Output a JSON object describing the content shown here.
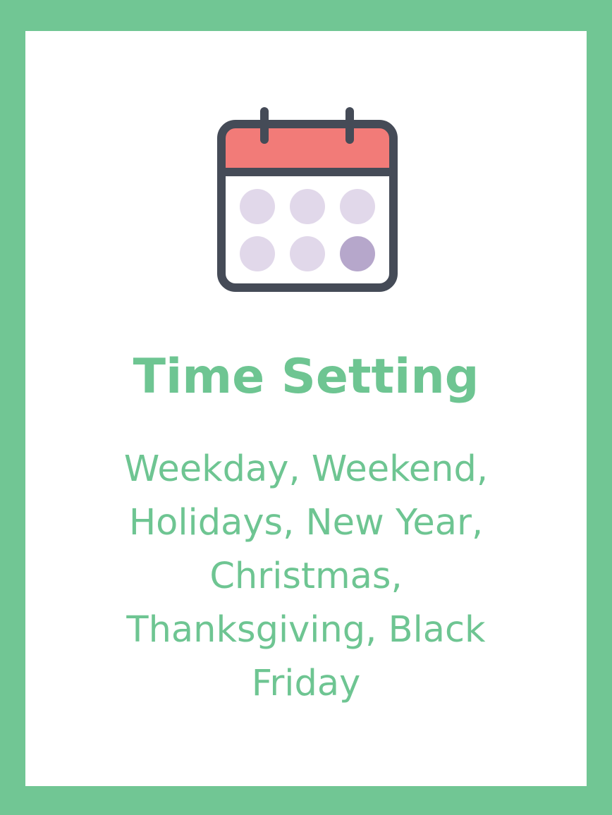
{
  "card": {
    "icon": "calendar-icon",
    "title": "Time Setting",
    "description": "Weekday, Weekend, Holidays, New Year, Christmas, Thanksgiving, Black Friday"
  },
  "colors": {
    "border": "#71c694",
    "text": "#6ec592",
    "calendar_header": "#f27b78",
    "calendar_outline": "#454b57",
    "dot_light": "#e1d8ea",
    "dot_dark": "#b6a7cb"
  }
}
